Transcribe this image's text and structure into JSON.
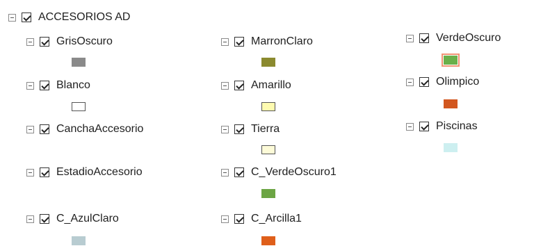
{
  "tree": {
    "root": {
      "label": "ACCESORIOS AD",
      "checked": true,
      "expanded": true
    },
    "layers": [
      {
        "label": "GrisOscuro",
        "checked": true,
        "expanded": true,
        "color": "#8a8a8a",
        "outlined": false
      },
      {
        "label": "Blanco",
        "checked": true,
        "expanded": true,
        "color": "#ffffff",
        "outlined": true
      },
      {
        "label": "CanchaAccesorio",
        "checked": true,
        "expanded": true
      },
      {
        "label": "EstadioAccesorio",
        "checked": true,
        "expanded": true
      },
      {
        "label": "C_AzulClaro",
        "checked": true,
        "expanded": true,
        "color": "#b8ccd1",
        "outlined": false
      },
      {
        "label": "MarronClaro",
        "checked": true,
        "expanded": true,
        "color": "#8b8a2f",
        "outlined": false
      },
      {
        "label": "Amarillo",
        "checked": true,
        "expanded": true,
        "color": "#fefbb0",
        "outlined": true
      },
      {
        "label": "Tierra",
        "checked": true,
        "expanded": true,
        "color": "#fdfbd8",
        "outlined": true
      },
      {
        "label": "C_VerdeOscuro1",
        "checked": true,
        "expanded": true,
        "color": "#6ca544",
        "outlined": false
      },
      {
        "label": "C_Arcilla1",
        "checked": true,
        "expanded": true,
        "color": "#df5f1a",
        "outlined": false
      },
      {
        "label": "VerdeOscuro",
        "checked": true,
        "expanded": true,
        "color": "#6ab04a",
        "outlined": false,
        "selected": true
      },
      {
        "label": "Olimpico",
        "checked": true,
        "expanded": true,
        "color": "#d2571f",
        "outlined": false
      },
      {
        "label": "Piscinas",
        "checked": true,
        "expanded": true,
        "color": "#cdeff0",
        "outlined": false
      }
    ]
  }
}
